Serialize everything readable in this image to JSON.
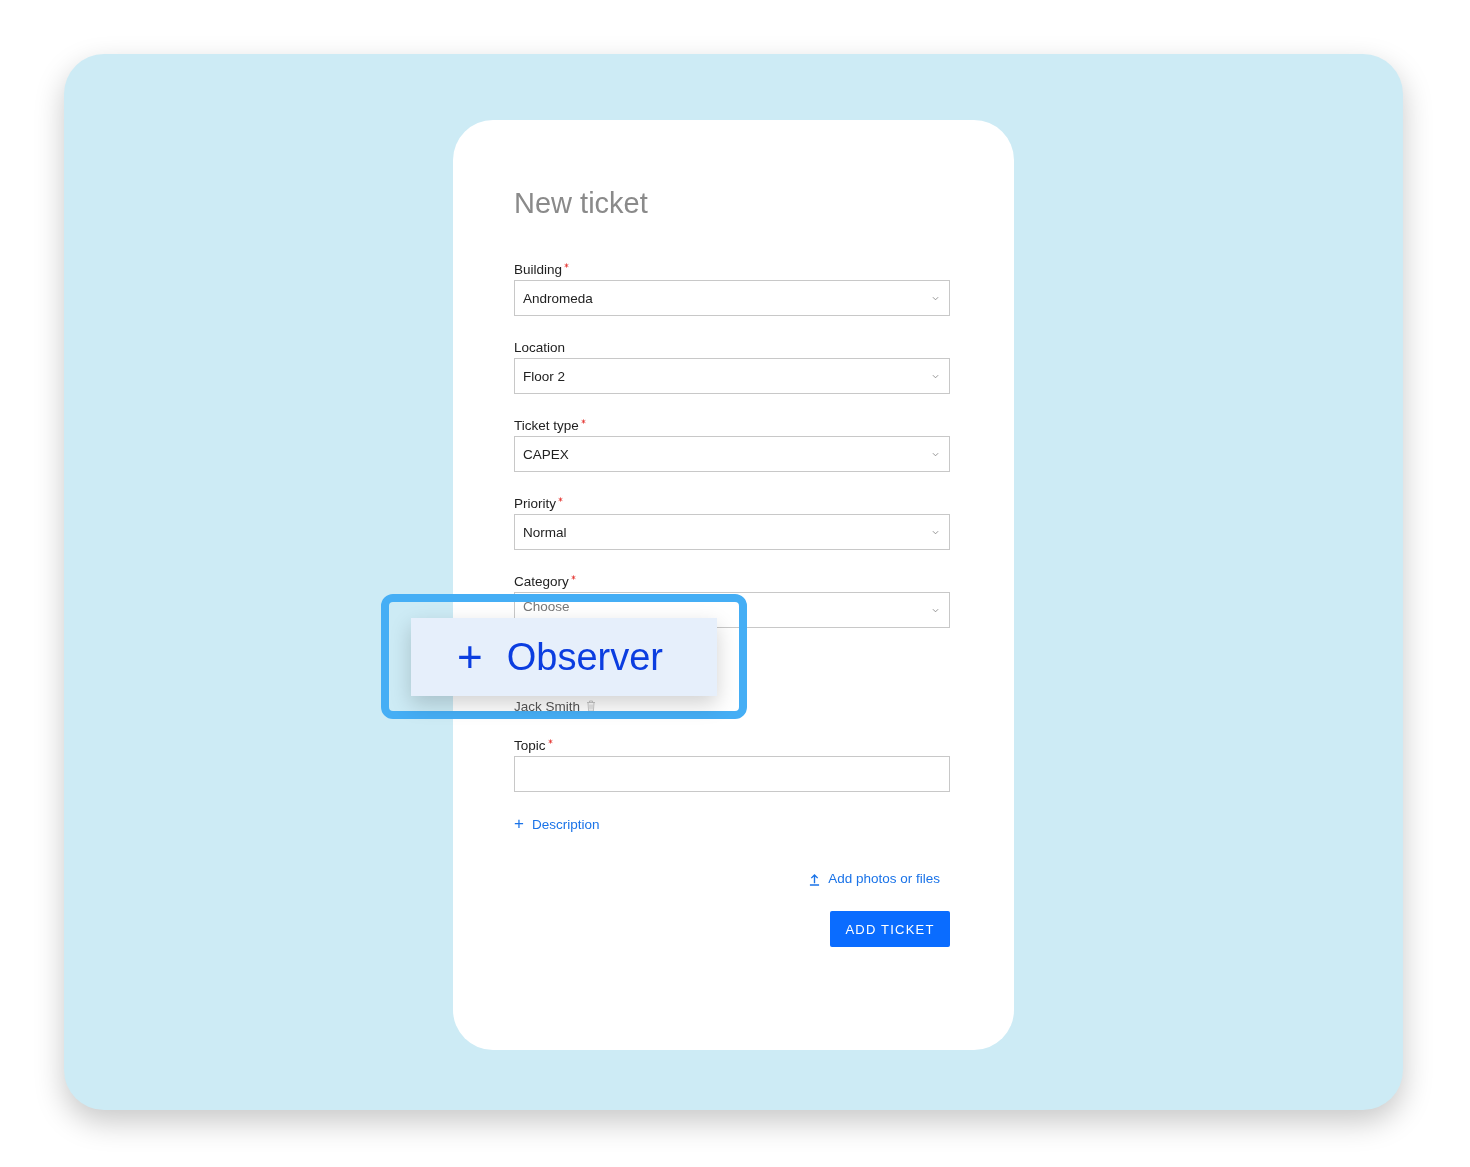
{
  "form": {
    "title": "New ticket",
    "fields": [
      {
        "kind": "select",
        "label": "Building",
        "required": true,
        "value": "Andromeda"
      },
      {
        "kind": "select",
        "label": "Location",
        "required": false,
        "value": "Floor 2"
      },
      {
        "kind": "select",
        "label": "Ticket type",
        "required": true,
        "value": "CAPEX"
      },
      {
        "kind": "select",
        "label": "Priority",
        "required": true,
        "value": "Normal"
      },
      {
        "kind": "select",
        "label": "Category",
        "required": true,
        "placeholder": "Choose"
      }
    ],
    "observers": [
      "Jack Smith"
    ],
    "topic": {
      "kind": "text",
      "label": "Topic",
      "required": true
    },
    "description_link": {
      "icon": "+",
      "label": "Description"
    },
    "upload_link": "Add photos or files",
    "submit_button": "ADD TICKET"
  },
  "callout": {
    "icon": "+",
    "label": "Observer"
  }
}
